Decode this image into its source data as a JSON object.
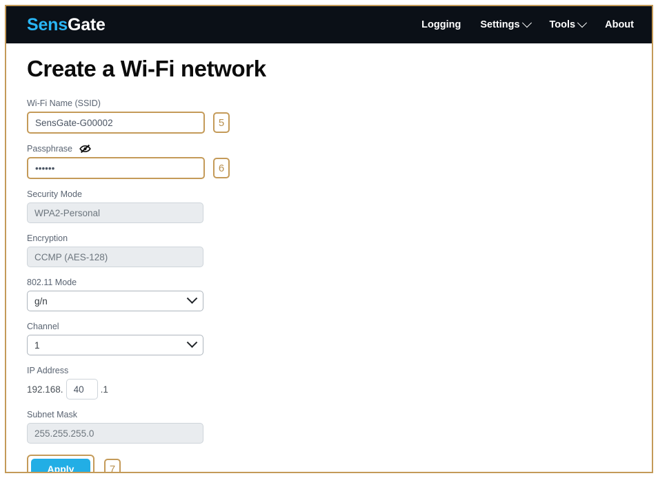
{
  "brand": {
    "part1": "Sens",
    "part2": "Gate",
    "color1": "#29b6f6",
    "color2": "#ffffff"
  },
  "nav": {
    "items": [
      {
        "label": "Logging",
        "caret": false
      },
      {
        "label": "Settings",
        "caret": true
      },
      {
        "label": "Tools",
        "caret": true
      },
      {
        "label": "About",
        "caret": false
      }
    ]
  },
  "page": {
    "title": "Create a Wi-Fi network"
  },
  "form": {
    "ssid": {
      "label": "Wi-Fi Name (SSID)",
      "value": "SensGate-G00002",
      "badge": "5"
    },
    "passphrase": {
      "label": "Passphrase",
      "value": "••••••",
      "badge": "6",
      "icon": "eye-slash-icon"
    },
    "security_mode": {
      "label": "Security Mode",
      "value": "WPA2-Personal"
    },
    "encryption": {
      "label": "Encryption",
      "value": "CCMP (AES-128)"
    },
    "mode_80211": {
      "label": "802.11 Mode",
      "value": "g/n"
    },
    "channel": {
      "label": "Channel",
      "value": "1"
    },
    "ip_address": {
      "label": "IP Address",
      "prefix": "192.168.",
      "octet": "40",
      "suffix": ".1"
    },
    "subnet_mask": {
      "label": "Subnet Mask",
      "value": "255.255.255.0"
    },
    "apply": {
      "label": "Apply",
      "badge": "7",
      "color": "#22aee5"
    }
  },
  "annotation": {
    "border_color": "#c49a58"
  }
}
